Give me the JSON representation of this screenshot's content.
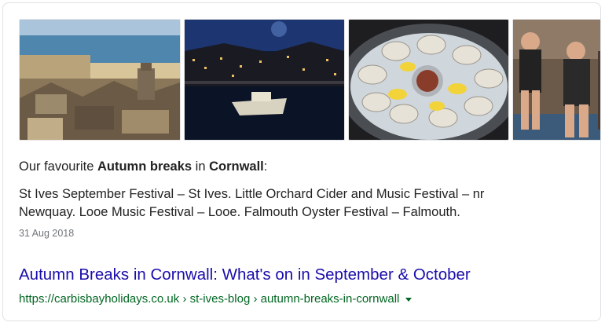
{
  "images": [
    {
      "alt": "St Ives harbour town view"
    },
    {
      "alt": "Harbour at night with boats"
    },
    {
      "alt": "Platter of oysters with lemon"
    },
    {
      "alt": "People at outdoor festival"
    }
  ],
  "snippet": {
    "heading_prefix": "Our favourite ",
    "heading_bold1": "Autumn breaks",
    "heading_mid": " in ",
    "heading_bold2": "Cornwall",
    "heading_suffix": ":",
    "body_line1": "St Ives September Festival – St Ives. Little Orchard Cider and Music Festival – nr",
    "body_line2": "Newquay. Looe Music Festival – Looe. Falmouth Oyster Festival – Falmouth.",
    "date": "31 Aug 2018"
  },
  "result": {
    "title": "Autumn Breaks in Cornwall: What's on in September & October",
    "url": "https://carbisbayholidays.co.uk › st-ives-blog › autumn-breaks-in-cornwall"
  },
  "colors": {
    "link": "#1a0dab",
    "url_green": "#006621",
    "text": "#222222",
    "meta_gray": "#70757a"
  }
}
